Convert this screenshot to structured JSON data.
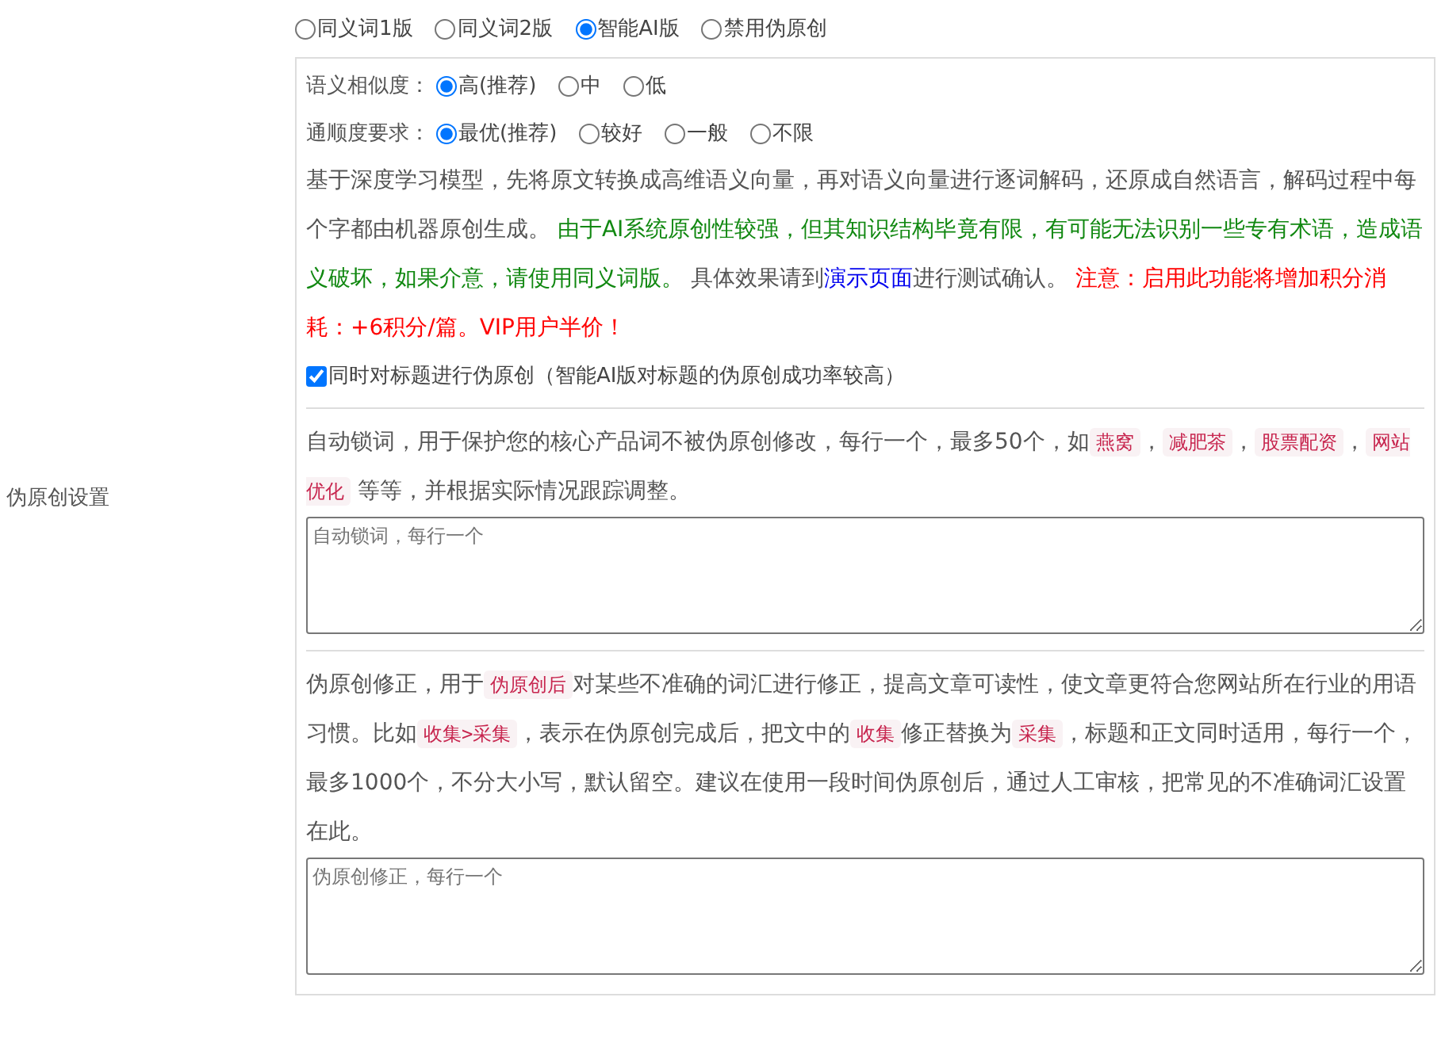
{
  "section_label": "伪原创设置",
  "modes": [
    {
      "label": "同义词1版",
      "selected": false
    },
    {
      "label": "同义词2版",
      "selected": false
    },
    {
      "label": "智能AI版",
      "selected": true
    },
    {
      "label": "禁用伪原创",
      "selected": false
    }
  ],
  "option_groups": [
    {
      "label": "语义相似度：",
      "options": [
        {
          "label": "高(推荐)",
          "selected": true
        },
        {
          "label": "中",
          "selected": false
        },
        {
          "label": "低",
          "selected": false
        }
      ]
    },
    {
      "label": "通顺度要求：",
      "options": [
        {
          "label": "最优(推荐)",
          "selected": true
        },
        {
          "label": "较好",
          "selected": false
        },
        {
          "label": "一般",
          "selected": false
        },
        {
          "label": "不限",
          "selected": false
        }
      ]
    }
  ],
  "ai_description": [
    {
      "kind": "plain",
      "text": "基于深度学习模型，先将原文转换成高维语义向量，再对语义向量进行逐词解码，还原成自然语言，解码过程中每个字都由机器原创生成。 "
    },
    {
      "kind": "green",
      "text": "由于AI系统原创性较强，但其知识结构毕竟有限，有可能无法识别一些专有术语，造成语义破坏，如果介意，请使用同义词版。"
    },
    {
      "kind": "plain",
      "text": " 具体效果请到"
    },
    {
      "kind": "link",
      "text": "演示页面"
    },
    {
      "kind": "plain",
      "text": "进行测试确认。 "
    },
    {
      "kind": "red",
      "text": "注意：启用此功能将增加积分消耗：+6积分/篇。VIP用户半价！"
    }
  ],
  "title_checkbox": {
    "label": "同时对标题进行伪原创（智能AI版对标题的伪原创成功率较高）",
    "checked": true
  },
  "lock_words": {
    "description": [
      {
        "kind": "plain",
        "text": "自动锁词，用于保护您的核心产品词不被伪原创修改，每行一个，最多50个，如"
      },
      {
        "kind": "code",
        "text": "燕窝"
      },
      {
        "kind": "plain",
        "text": "，"
      },
      {
        "kind": "code",
        "text": "减肥茶"
      },
      {
        "kind": "plain",
        "text": "，"
      },
      {
        "kind": "code",
        "text": "股票配资"
      },
      {
        "kind": "plain",
        "text": "，"
      },
      {
        "kind": "code",
        "text": "网站优化"
      },
      {
        "kind": "plain",
        "text": " 等等，并根据实际情况跟踪调整。"
      }
    ],
    "placeholder": "自动锁词，每行一个"
  },
  "corrections": {
    "description": [
      {
        "kind": "plain",
        "text": "伪原创修正，用于"
      },
      {
        "kind": "code",
        "text": "伪原创后"
      },
      {
        "kind": "plain",
        "text": "对某些不准确的词汇进行修正，提高文章可读性，使文章更符合您网站所在行业的用语习惯。比如"
      },
      {
        "kind": "code",
        "text": "收集>采集"
      },
      {
        "kind": "plain",
        "text": "，表示在伪原创完成后，把文中的"
      },
      {
        "kind": "code",
        "text": "收集"
      },
      {
        "kind": "plain",
        "text": "修正替换为"
      },
      {
        "kind": "code",
        "text": "采集"
      },
      {
        "kind": "plain",
        "text": "，标题和正文同时适用，每行一个，最多1000个，不分大小写，默认留空。建议在使用一段时间伪原创后，通过人工审核，把常见的不准确词汇设置在此。"
      }
    ],
    "placeholder": "伪原创修正，每行一个"
  }
}
